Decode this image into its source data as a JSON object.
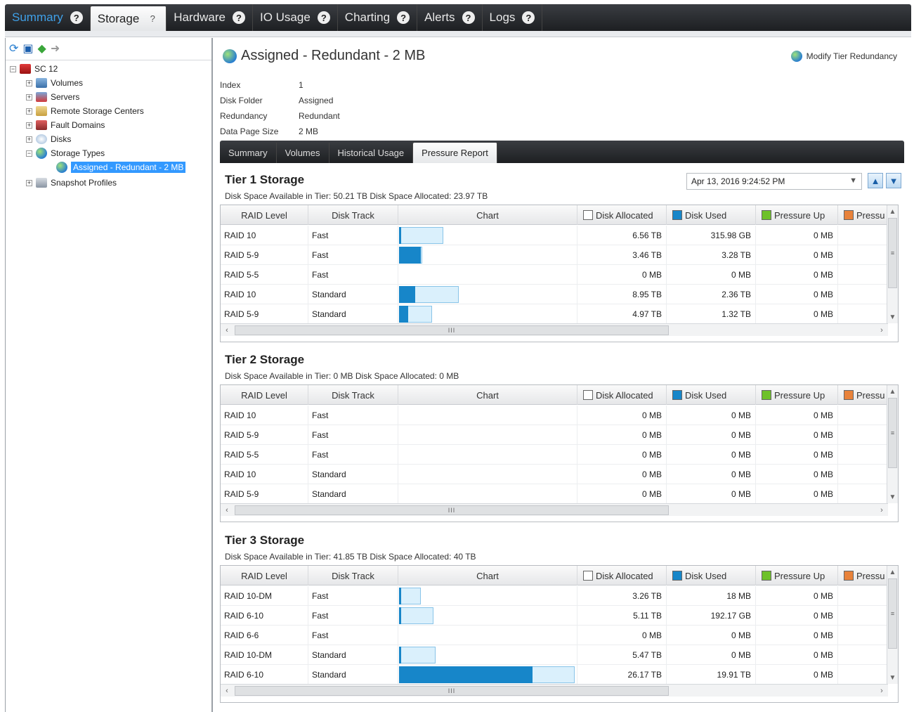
{
  "top_tabs": [
    {
      "label": "Summary",
      "help": "?"
    },
    {
      "label": "Storage",
      "help": "?"
    },
    {
      "label": "Hardware",
      "help": "?"
    },
    {
      "label": "IO Usage",
      "help": "?"
    },
    {
      "label": "Charting",
      "help": "?"
    },
    {
      "label": "Alerts",
      "help": "?"
    },
    {
      "label": "Logs",
      "help": "?"
    }
  ],
  "tree": {
    "root": "SC 12",
    "items": [
      "Volumes",
      "Servers",
      "Remote Storage Centers",
      "Fault Domains",
      "Disks",
      "Storage Types",
      "Assigned - Redundant - 2 MB",
      "Snapshot Profiles"
    ]
  },
  "header": {
    "title": "Assigned - Redundant - 2 MB",
    "modify_label": "Modify Tier Redundancy"
  },
  "properties": [
    {
      "key": "Index",
      "value": "1"
    },
    {
      "key": "Disk Folder",
      "value": "Assigned"
    },
    {
      "key": "Redundancy",
      "value": "Redundant"
    },
    {
      "key": "Data Page Size",
      "value": "2 MB"
    }
  ],
  "sub_tabs": [
    "Summary",
    "Volumes",
    "Historical Usage",
    "Pressure Report"
  ],
  "date_selector": "Apr 13, 2016 9:24:52 PM",
  "columns": [
    "RAID Level",
    "Disk Track",
    "Chart",
    "Disk Allocated",
    "Disk Used",
    "Pressure Up",
    "Pressu"
  ],
  "colors": {
    "allocated": "#daf0fc",
    "used": "#1786c9",
    "pressure_up": "#6ec12a",
    "pressure_down": "#e8823a"
  },
  "scroll_thumb": "≡",
  "hscroll_thumb": "III",
  "tiers": [
    {
      "title": "Tier 1 Storage",
      "stats": "Disk Space Available in Tier: 50.21 TB   Disk Space Allocated: 23.97 TB",
      "rows": [
        {
          "raid": "RAID 10",
          "track": "Fast",
          "allocated": "6.56 TB",
          "used": "315.98 GB",
          "pressure_up": "0 MB",
          "alloc_tb": 6.56,
          "used_tb": 0.3086
        },
        {
          "raid": "RAID 5-9",
          "track": "Fast",
          "allocated": "3.46 TB",
          "used": "3.28 TB",
          "pressure_up": "0 MB",
          "alloc_tb": 3.46,
          "used_tb": 3.28
        },
        {
          "raid": "RAID 5-5",
          "track": "Fast",
          "allocated": "0 MB",
          "used": "0 MB",
          "pressure_up": "0 MB",
          "alloc_tb": 0,
          "used_tb": 0
        },
        {
          "raid": "RAID 10",
          "track": "Standard",
          "allocated": "8.95 TB",
          "used": "2.36 TB",
          "pressure_up": "0 MB",
          "alloc_tb": 8.95,
          "used_tb": 2.36
        },
        {
          "raid": "RAID 5-9",
          "track": "Standard",
          "allocated": "4.97 TB",
          "used": "1.32 TB",
          "pressure_up": "0 MB",
          "alloc_tb": 4.97,
          "used_tb": 1.32
        }
      ]
    },
    {
      "title": "Tier 2 Storage",
      "stats": "Disk Space Available in Tier: 0 MB   Disk Space Allocated: 0 MB",
      "rows": [
        {
          "raid": "RAID 10",
          "track": "Fast",
          "allocated": "0 MB",
          "used": "0 MB",
          "pressure_up": "0 MB",
          "alloc_tb": 0,
          "used_tb": 0
        },
        {
          "raid": "RAID 5-9",
          "track": "Fast",
          "allocated": "0 MB",
          "used": "0 MB",
          "pressure_up": "0 MB",
          "alloc_tb": 0,
          "used_tb": 0
        },
        {
          "raid": "RAID 5-5",
          "track": "Fast",
          "allocated": "0 MB",
          "used": "0 MB",
          "pressure_up": "0 MB",
          "alloc_tb": 0,
          "used_tb": 0
        },
        {
          "raid": "RAID 10",
          "track": "Standard",
          "allocated": "0 MB",
          "used": "0 MB",
          "pressure_up": "0 MB",
          "alloc_tb": 0,
          "used_tb": 0
        },
        {
          "raid": "RAID 5-9",
          "track": "Standard",
          "allocated": "0 MB",
          "used": "0 MB",
          "pressure_up": "0 MB",
          "alloc_tb": 0,
          "used_tb": 0
        }
      ]
    },
    {
      "title": "Tier 3 Storage",
      "stats": "Disk Space Available in Tier: 41.85 TB   Disk Space Allocated: 40 TB",
      "rows": [
        {
          "raid": "RAID 10-DM",
          "track": "Fast",
          "allocated": "3.26 TB",
          "used": "18 MB",
          "pressure_up": "0 MB",
          "alloc_tb": 3.26,
          "used_tb": 2e-05
        },
        {
          "raid": "RAID 6-10",
          "track": "Fast",
          "allocated": "5.11 TB",
          "used": "192.17 GB",
          "pressure_up": "0 MB",
          "alloc_tb": 5.11,
          "used_tb": 0.1877
        },
        {
          "raid": "RAID 6-6",
          "track": "Fast",
          "allocated": "0 MB",
          "used": "0 MB",
          "pressure_up": "0 MB",
          "alloc_tb": 0,
          "used_tb": 0
        },
        {
          "raid": "RAID 10-DM",
          "track": "Standard",
          "allocated": "5.47 TB",
          "used": "0 MB",
          "pressure_up": "0 MB",
          "alloc_tb": 5.47,
          "used_tb": 0
        },
        {
          "raid": "RAID 6-10",
          "track": "Standard",
          "allocated": "26.17 TB",
          "used": "19.91 TB",
          "pressure_up": "0 MB",
          "alloc_tb": 26.17,
          "used_tb": 19.91
        }
      ]
    }
  ]
}
